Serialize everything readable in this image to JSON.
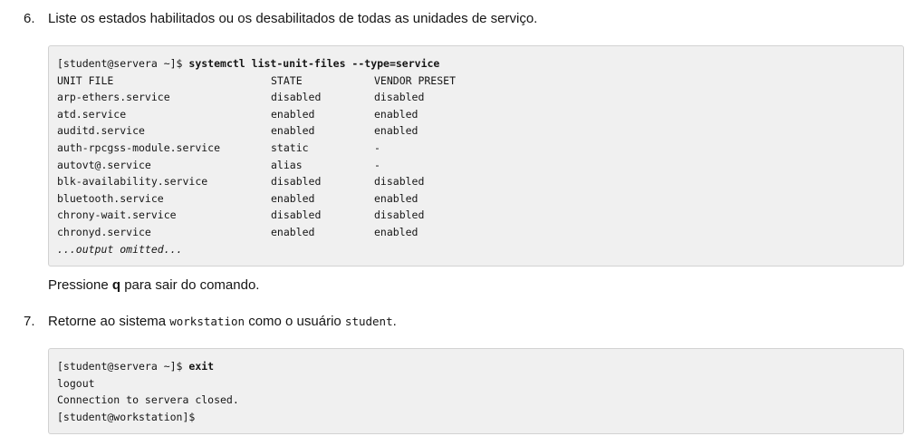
{
  "step6": {
    "number": "6.",
    "text": "Liste os estados habilitados ou os desabilitados de todas as unidades de serviço."
  },
  "terminal1": {
    "prompt": "[student@servera ~]$ ",
    "command": "systemctl list-unit-files --type=service",
    "headers": [
      "UNIT FILE",
      "STATE",
      "VENDOR PRESET"
    ],
    "rows": [
      [
        "arp-ethers.service",
        "disabled",
        "disabled"
      ],
      [
        "atd.service",
        "enabled",
        "enabled"
      ],
      [
        "auditd.service",
        "enabled",
        "enabled"
      ],
      [
        "auth-rpcgss-module.service",
        "static",
        "-"
      ],
      [
        "autovt@.service",
        "alias",
        "-"
      ],
      [
        "blk-availability.service",
        "disabled",
        "disabled"
      ],
      [
        "bluetooth.service",
        "enabled",
        "enabled"
      ],
      [
        "chrony-wait.service",
        "disabled",
        "disabled"
      ],
      [
        "chronyd.service",
        "enabled",
        "enabled"
      ]
    ],
    "omitted": "...output omitted..."
  },
  "note": {
    "before": "Pressione ",
    "key": "q",
    "after": " para sair do comando."
  },
  "step7": {
    "number": "7.",
    "text_before": "Retorne ao sistema ",
    "code1": "workstation",
    "text_middle": " como o usuário ",
    "code2": "student",
    "text_after": "."
  },
  "terminal2": {
    "prompt": "[student@servera ~]$ ",
    "command": "exit",
    "lines": [
      "logout",
      "Connection to servera closed.",
      "[student@workstation]$"
    ]
  }
}
